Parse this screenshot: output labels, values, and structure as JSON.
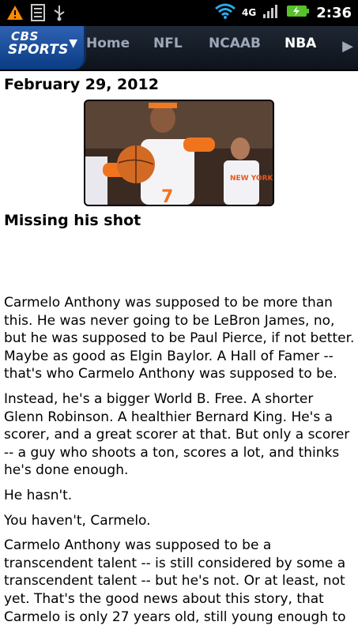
{
  "status_bar": {
    "time": "2:36",
    "network": "4G",
    "icons": [
      "warning-icon",
      "sim-card-icon",
      "usb-icon",
      "wifi-icon",
      "4g-icon",
      "signal-icon",
      "battery-charging-icon"
    ]
  },
  "nav": {
    "logo_top": "CBS",
    "logo_bottom": "SPORTS",
    "tabs": [
      {
        "label": "Home"
      },
      {
        "label": "NFL"
      },
      {
        "label": "NCAAB"
      },
      {
        "label": "NBA",
        "active": true
      }
    ]
  },
  "article": {
    "date": "February 29, 2012",
    "headline": "Missing his shot",
    "paragraphs": [
      "Carmelo Anthony was supposed to be more than this. He was never going to be LeBron James, no, but he was supposed to be Paul Pierce, if not better. Maybe as good as Elgin Baylor. A Hall of Famer -- that's who Carmelo Anthony was supposed to be.",
      "Instead, he's a bigger World B. Free. A shorter Glenn Robinson. A healthier Bernard King. He's a scorer, and a great scorer at that. But only a scorer -- a guy who shoots a ton, scores a lot, and thinks he's done enough.",
      "He hasn't.",
      "You haven't, Carmelo.",
      "Carmelo Anthony was supposed to be a transcendent talent -- is still considered by some a transcendent talent -- but he's not. Or at least, not yet. That's the good news about this story, that Carmelo is only 27 years old, still young enough to"
    ]
  },
  "colors": {
    "nav_bg": "#141a23",
    "logo_blue": "#1d4f9e",
    "tab_inactive": "#9ca7b8",
    "tab_active": "#ffffff"
  }
}
